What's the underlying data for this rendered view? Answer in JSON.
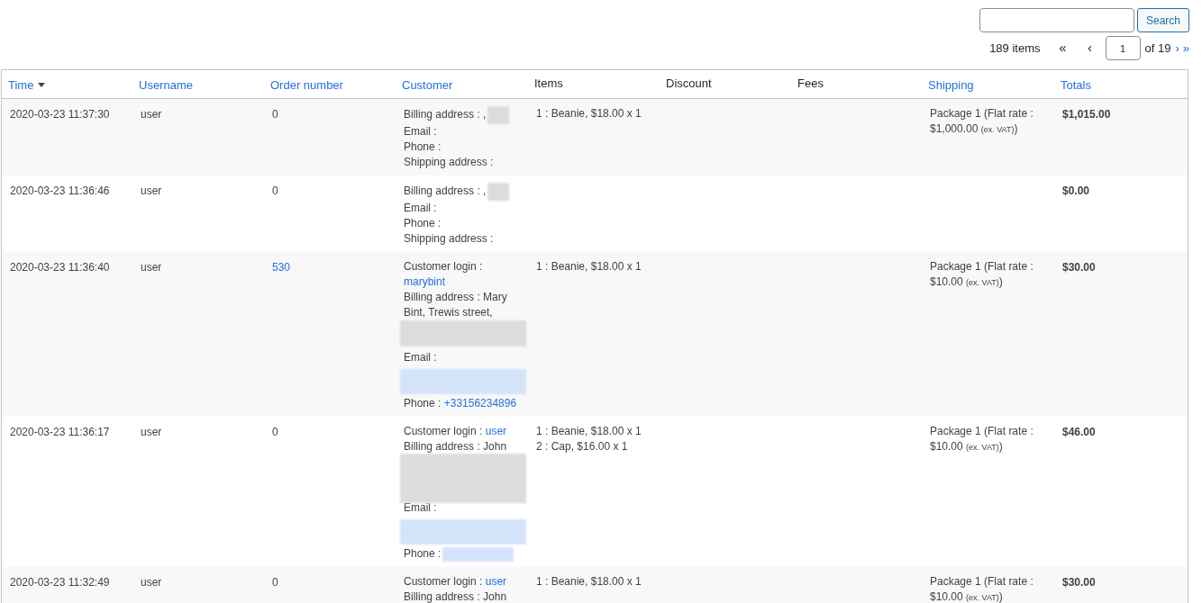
{
  "search": {
    "button": "Search"
  },
  "pagination": {
    "count": "189 items",
    "first": "«",
    "prev": "‹",
    "page": "1",
    "of": "of 19",
    "next": "›",
    "last": "»"
  },
  "table": {
    "columns": [
      {
        "label": "Time",
        "sortable": true,
        "sorted": true
      },
      {
        "label": "Username",
        "sortable": true,
        "sorted": false
      },
      {
        "label": "Order number",
        "sortable": true,
        "sorted": false
      },
      {
        "label": "Customer",
        "sortable": true,
        "sorted": false
      },
      {
        "label": "Items",
        "sortable": false,
        "sorted": false
      },
      {
        "label": "Discount",
        "sortable": false,
        "sorted": false
      },
      {
        "label": "Fees",
        "sortable": false,
        "sorted": false
      },
      {
        "label": "Shipping",
        "sortable": true,
        "sorted": false
      },
      {
        "label": "Totals",
        "sortable": true,
        "sorted": false
      }
    ],
    "rows": [
      {
        "time": "2020-03-23 11:37:30",
        "username": "user",
        "order": "0",
        "order_link": false,
        "customer": [
          {
            "kind": "blurred",
            "text": "Billing address : ,"
          },
          {
            "kind": "plain",
            "text": "Email :"
          },
          {
            "kind": "plain",
            "text": "Phone :"
          },
          {
            "kind": "plain",
            "text": "Shipping address :"
          }
        ],
        "items": [
          "1 : Beanie, $18.00 x 1"
        ],
        "shipping": {
          "text": "Package 1 (Flat rate : $1,000.00",
          "note": "(ex. VAT)",
          "close": ")"
        },
        "total": "$1,015.00"
      },
      {
        "time": "2020-03-23 11:36:46",
        "username": "user",
        "order": "0",
        "order_link": false,
        "customer": [
          {
            "kind": "blurred",
            "text": "Billing address : ,"
          },
          {
            "kind": "plain",
            "text": "Email :"
          },
          {
            "kind": "plain",
            "text": "Phone :"
          },
          {
            "kind": "plain",
            "text": "Shipping address :"
          }
        ],
        "items": [],
        "total": "$0.00"
      },
      {
        "time": "2020-03-23 11:36:40",
        "username": "user",
        "order": "530",
        "order_link": true,
        "customer": [
          {
            "kind": "plain",
            "text": "Customer login :",
            "link": "marybint"
          },
          {
            "kind": "plain",
            "text": "Billing address : Mary Bint, Trewis street,"
          },
          {
            "kind": "blurblock"
          },
          {
            "kind": "plain",
            "text": "Email :"
          },
          {
            "kind": "linkblurblock"
          },
          {
            "kind": "plain",
            "text": "Phone :",
            "link": "+33156234896"
          }
        ],
        "items": [
          "1 : Beanie, $18.00 x 1"
        ],
        "shipping": {
          "text": "Package 1 (Flat rate : $10.00",
          "note": "(ex. VAT)",
          "close": ")"
        },
        "total": "$30.00"
      },
      {
        "time": "2020-03-23 11:36:17",
        "username": "user",
        "order": "0",
        "order_link": false,
        "customer": [
          {
            "kind": "plain",
            "text": "Customer login :",
            "link": "user"
          },
          {
            "kind": "plain",
            "text": "Billing address : John"
          },
          {
            "kind": "tallblurblock"
          },
          {
            "kind": "plain",
            "text": "Email :"
          },
          {
            "kind": "linkblurblock"
          },
          {
            "kind": "linkblurred",
            "text": "Phone :"
          }
        ],
        "items": [
          "1 : Beanie, $18.00 x 1",
          "2 : Cap, $16.00 x 1"
        ],
        "shipping": {
          "text": "Package 1 (Flat rate : $10.00",
          "note": "(ex. VAT)",
          "close": ")"
        },
        "total": "$46.00"
      },
      {
        "time": "2020-03-23 11:32:49",
        "username": "user",
        "order": "0",
        "order_link": false,
        "customer": [
          {
            "kind": "plain",
            "text": "Customer login :",
            "link": "user"
          },
          {
            "kind": "plain",
            "text": "Billing address : John"
          }
        ],
        "items": [
          "1 : Beanie, $18.00 x 1"
        ],
        "shipping": {
          "text": "Package 1 (Flat rate : $10.00",
          "note": "(ex. VAT)",
          "close": ")"
        },
        "total": "$30.00"
      }
    ]
  }
}
